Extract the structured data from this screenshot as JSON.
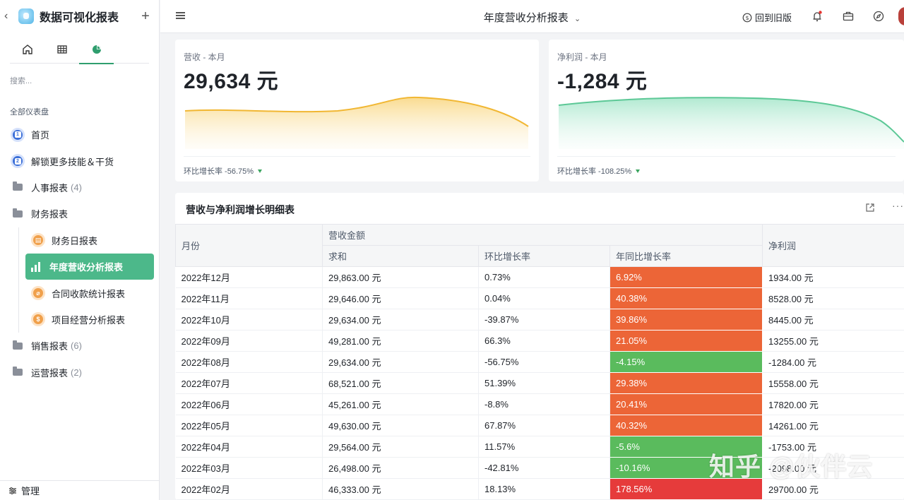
{
  "sidebar": {
    "app_title": "数据可视化报表",
    "search_placeholder": "搜索...",
    "section_title": "全部仪表盘",
    "items": [
      {
        "label": "首页",
        "badge": "1"
      },
      {
        "label": "解锁更多技能＆干货",
        "badge": "2"
      },
      {
        "label": "人事报表",
        "count": "(4)"
      },
      {
        "label": "财务报表"
      }
    ],
    "finance_sub": [
      {
        "label": "财务日报表"
      },
      {
        "label": "年度营收分析报表"
      },
      {
        "label": "合同收款统计报表"
      },
      {
        "label": "项目经营分析报表"
      }
    ],
    "more_items": [
      {
        "label": "销售报表",
        "count": "(6)"
      },
      {
        "label": "运营报表",
        "count": "(2)"
      }
    ],
    "footer_label": "管理"
  },
  "topbar": {
    "title": "年度营收分析报表",
    "back_old_label": "回到旧版"
  },
  "kpis": [
    {
      "label": "营收 - 本月",
      "value": "29,634 元",
      "footer": "环比增长率 -56.75%",
      "color": "#f5c24b"
    },
    {
      "label": "净利润 - 本月",
      "value": "-1,284 元",
      "footer": "环比增长率 -108.25%",
      "color": "#6fd0a4"
    }
  ],
  "table": {
    "title": "营收与净利润增长明细表",
    "headers": {
      "month": "月份",
      "revenue_group": "营收金额",
      "sum": "求和",
      "mom": "环比增长率",
      "yoy": "年同比增长率",
      "profit": "净利润"
    },
    "rows": [
      {
        "month": "2022年12月",
        "sum": "29,863.00 元",
        "mom": "0.73%",
        "yoy": "6.92%",
        "profit": "1934.00 元",
        "yoy_class": "c-red"
      },
      {
        "month": "2022年11月",
        "sum": "29,646.00 元",
        "mom": "0.04%",
        "yoy": "40.38%",
        "profit": "8528.00 元",
        "yoy_class": "c-red"
      },
      {
        "month": "2022年10月",
        "sum": "29,634.00 元",
        "mom": "-39.87%",
        "yoy": "39.86%",
        "profit": "8445.00 元",
        "yoy_class": "c-red"
      },
      {
        "month": "2022年09月",
        "sum": "49,281.00 元",
        "mom": "66.3%",
        "yoy": "21.05%",
        "profit": "13255.00 元",
        "yoy_class": "c-red"
      },
      {
        "month": "2022年08月",
        "sum": "29,634.00 元",
        "mom": "-56.75%",
        "yoy": "-4.15%",
        "profit": "-1284.00 元",
        "yoy_class": "c-green"
      },
      {
        "month": "2022年07月",
        "sum": "68,521.00 元",
        "mom": "51.39%",
        "yoy": "29.38%",
        "profit": "15558.00 元",
        "yoy_class": "c-red"
      },
      {
        "month": "2022年06月",
        "sum": "45,261.00 元",
        "mom": "-8.8%",
        "yoy": "20.41%",
        "profit": "17820.00 元",
        "yoy_class": "c-red"
      },
      {
        "month": "2022年05月",
        "sum": "49,630.00 元",
        "mom": "67.87%",
        "yoy": "40.32%",
        "profit": "14261.00 元",
        "yoy_class": "c-red"
      },
      {
        "month": "2022年04月",
        "sum": "29,564.00 元",
        "mom": "11.57%",
        "yoy": "-5.6%",
        "profit": "-1753.00 元",
        "yoy_class": "c-green"
      },
      {
        "month": "2022年03月",
        "sum": "26,498.00 元",
        "mom": "-42.81%",
        "yoy": "-10.16%",
        "profit": "-2098.00 元",
        "yoy_class": "c-green"
      },
      {
        "month": "2022年02月",
        "sum": "46,333.00 元",
        "mom": "18.13%",
        "yoy": "178.56%",
        "profit": "29700.00 元",
        "yoy_class": "c-crimson"
      }
    ]
  },
  "watermark": "知乎 @伙伴云"
}
